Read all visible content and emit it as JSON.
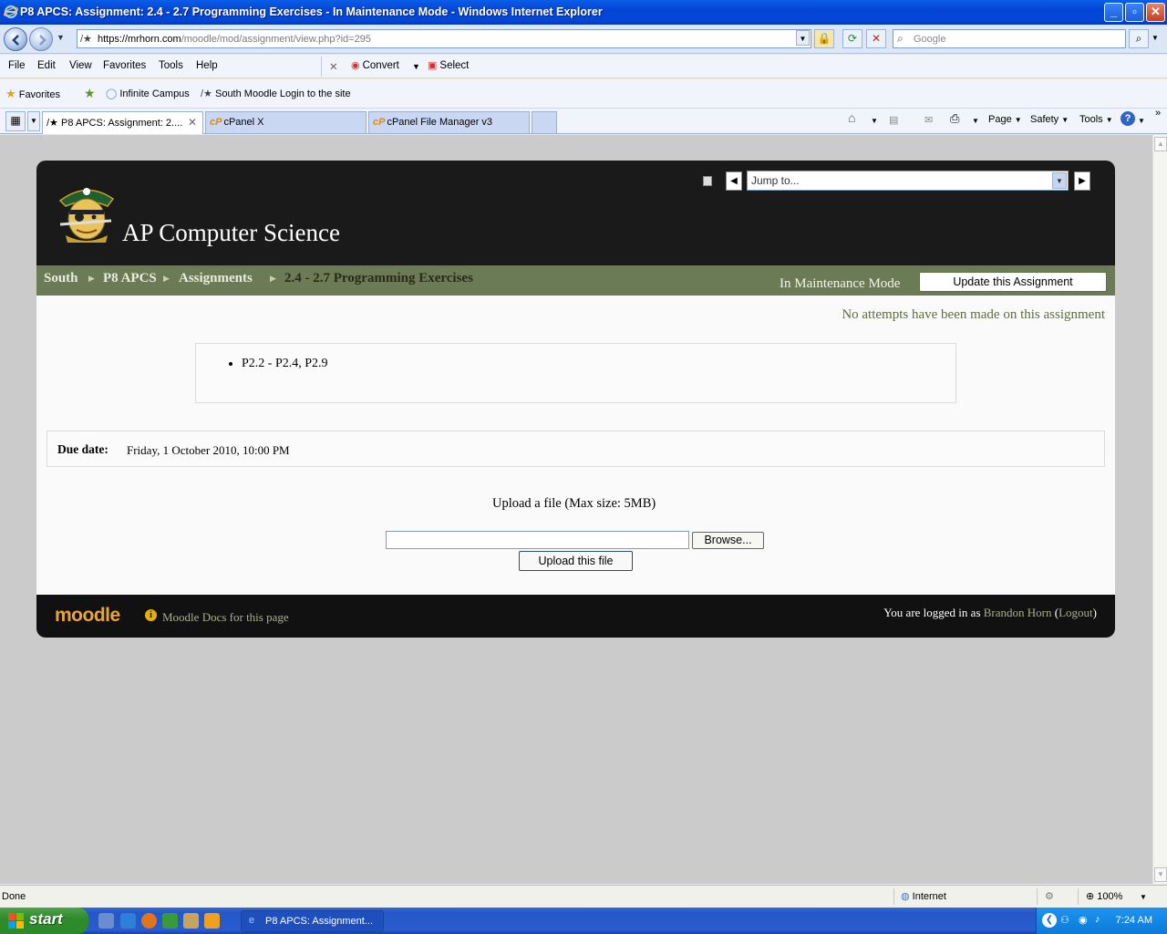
{
  "window": {
    "title": "P8 APCS: Assignment: 2.4 - 2.7 Programming Exercises - In Maintenance Mode - Windows Internet Explorer"
  },
  "address_bar": {
    "url_host": "https://mrhorn.com",
    "url_path": "/moodle/mod/assignment/view.php?id=295",
    "search_placeholder": "Google"
  },
  "menu": {
    "items": [
      "File",
      "Edit",
      "View",
      "Favorites",
      "Tools",
      "Help"
    ],
    "convert_label": "Convert",
    "select_label": "Select"
  },
  "favorites_bar": {
    "favorites_label": "Favorites",
    "links": [
      "Infinite Campus",
      "South Moodle Login to the site"
    ]
  },
  "tabs": [
    {
      "label": "P8 APCS: Assignment: 2....",
      "active": true
    },
    {
      "label": "cPanel X",
      "active": false
    },
    {
      "label": "cPanel File Manager v3",
      "active": false
    }
  ],
  "command_bar": {
    "page_label": "Page",
    "safety_label": "Safety",
    "tools_label": "Tools"
  },
  "moodle": {
    "course_title": "AP Computer Science",
    "jump_to": "Jump to...",
    "breadcrumb": [
      "South",
      "P8 APCS",
      "Assignments",
      "2.4 - 2.7 Programming Exercises"
    ],
    "maintenance_text": "In Maintenance Mode",
    "update_button": "Update this Assignment",
    "no_attempts": "No attempts have been made on this assignment",
    "intro_items": [
      "P2.2 - P2.4, P2.9"
    ],
    "due_label": "Due date:",
    "due_value": "Friday, 1 October 2010, 10:00 PM",
    "upload_label": "Upload a file (Max size: 5MB)",
    "browse_button": "Browse...",
    "upload_button": "Upload this file",
    "footer": {
      "logo_text": "moodle",
      "docs_link": "Moodle Docs for this page",
      "logged_in_prefix": "You are logged in as",
      "user_name": "Brandon Horn",
      "logout": "Logout"
    }
  },
  "status_bar": {
    "status": "Done",
    "zone": "Internet",
    "zoom": "100%"
  },
  "taskbar": {
    "start_label": "start",
    "task_label": "P8 APCS: Assignment...",
    "clock": "7:24 AM"
  }
}
